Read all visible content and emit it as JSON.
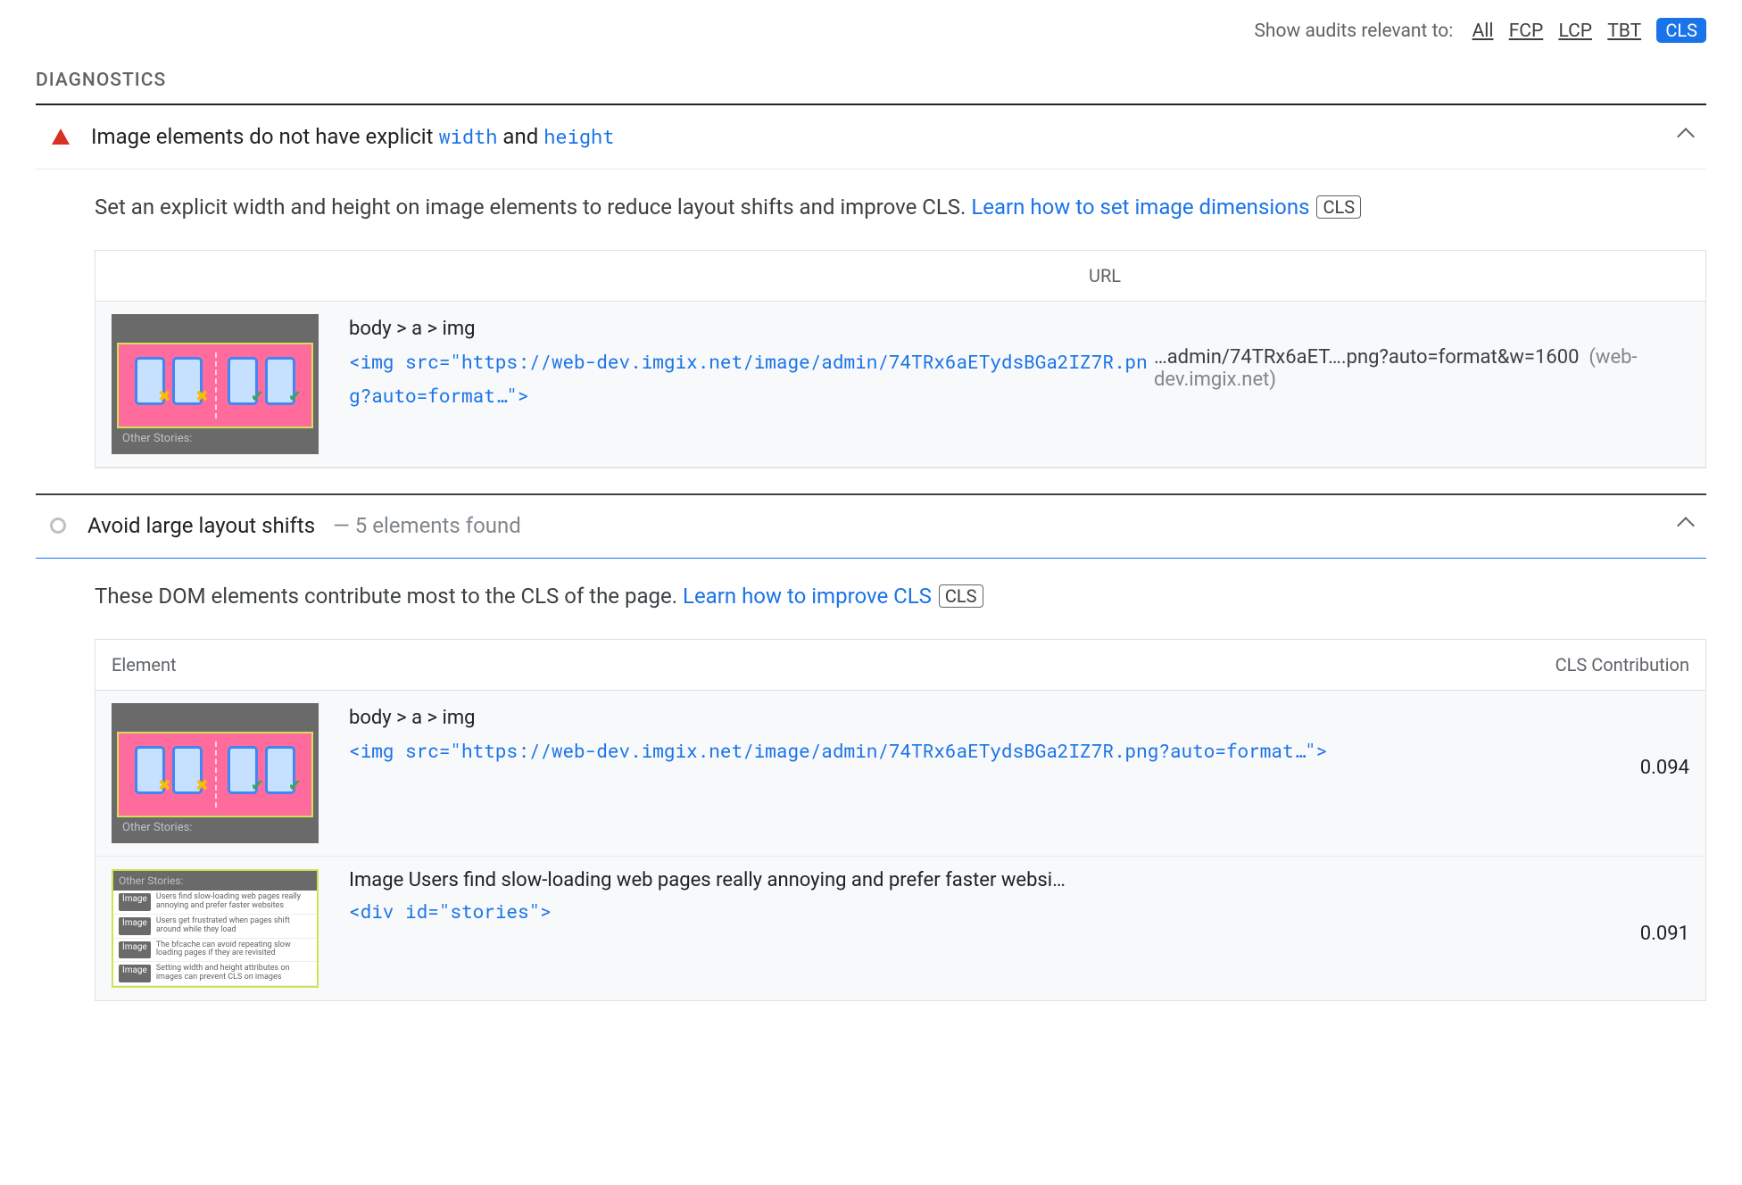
{
  "filter": {
    "label": "Show audits relevant to:",
    "options": [
      "All",
      "FCP",
      "LCP",
      "TBT"
    ],
    "active": "CLS"
  },
  "section": {
    "title": "DIAGNOSTICS"
  },
  "audit1": {
    "title_pre": "Image elements do not have explicit ",
    "code1": "width",
    "mid": " and ",
    "code2": "height",
    "desc": "Set an explicit width and height on image elements to reduce layout shifts and improve CLS. ",
    "link": "Learn how to set image dimensions",
    "chip": "CLS",
    "table": {
      "header_url": "URL",
      "row": {
        "caption": "Other Stories:",
        "selector": "body > a > img",
        "element": "<img src=\"https://web-dev.imgix.net/image/admin/74TRx6aETydsBGa2IZ7R.png?auto=format…\">",
        "url": "…admin/74TRx6aET….png?auto=format&w=1600",
        "host": "(web-dev.imgix.net)"
      }
    }
  },
  "audit2": {
    "title": "Avoid large layout shifts",
    "subnote": "5 elements found",
    "desc": "These DOM elements contribute most to the CLS of the page. ",
    "link": "Learn how to improve CLS",
    "chip": "CLS",
    "table": {
      "header_element": "Element",
      "header_score": "CLS Contribution",
      "rows": [
        {
          "caption": "Other Stories:",
          "selector": "body > a > img",
          "element": "<img src=\"https://web-dev.imgix.net/image/admin/74TRx6aETydsBGa2IZ7R.png?auto=format…\">",
          "score": "0.094"
        },
        {
          "label": "Image Users find slow-loading web pages really annoying and prefer faster websi…",
          "element": "<div id=\"stories\">",
          "score": "0.091",
          "mini": {
            "header": "Other Stories:",
            "lines": [
              "Users find slow-loading web pages really annoying and prefer faster websites",
              "Users get frustrated when pages shift around while they load",
              "The bfcache can avoid repeating slow loading pages if they are revisited",
              "Setting width and height attributes on images can prevent CLS on images"
            ]
          }
        }
      ]
    }
  }
}
